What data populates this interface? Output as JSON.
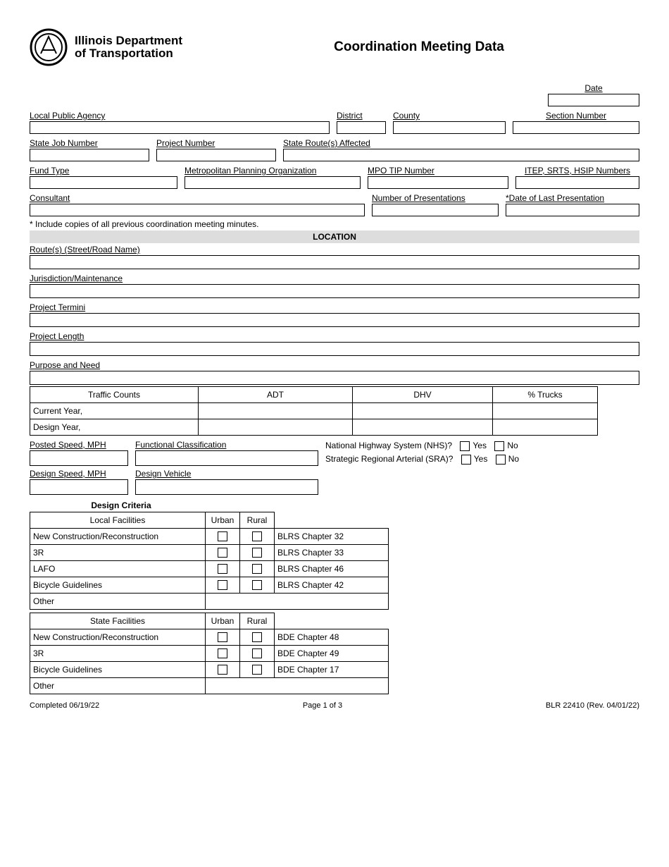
{
  "header": {
    "logo_line1": "Illinois Department",
    "logo_line2": "of Transportation",
    "title": "Coordination Meeting Data"
  },
  "top": {
    "date_label": "Date",
    "lpa_label": "Local Public Agency",
    "district_label": "District",
    "county_label": "County",
    "section_label": "Section Number",
    "state_job_label": "State Job Number",
    "project_number_label": "Project Number",
    "routes_affected_label": "State Route(s) Affected",
    "fund_type_label": "Fund Type",
    "mpo_label": "Metropolitan Planning Organization",
    "mpo_tip_label": "MPO TIP Number",
    "itep_label": "ITEP, SRTS, HSIP Numbers",
    "consultant_label": "Consultant",
    "num_presentations_label": "Number of Presentations",
    "last_presentation_label": "*Date of Last Presentation",
    "note": "* Include copies of all previous coordination meeting minutes."
  },
  "location": {
    "heading": "LOCATION",
    "routes_label": "Route(s) (Street/Road Name)",
    "jurisdiction_label": "Jurisdiction/Maintenance",
    "termini_label": "Project Termini",
    "length_label": "Project Length",
    "purpose_label": "Purpose and Need"
  },
  "traffic": {
    "col0": "Traffic Counts",
    "col1": "ADT",
    "col2": "DHV",
    "col3": "% Trucks",
    "row1": "Current Year,",
    "row2": "Design Year,"
  },
  "speed": {
    "posted_label": "Posted Speed, MPH",
    "functional_label": "Functional Classification",
    "nhs_label": "National Highway System (NHS)?",
    "sra_label": "Strategic Regional Arterial (SRA)?",
    "yes": "Yes",
    "no": "No",
    "design_speed_label": "Design Speed, MPH",
    "design_vehicle_label": "Design Vehicle"
  },
  "design_criteria": {
    "heading": "Design Criteria",
    "local": {
      "title": "Local Facilities",
      "urban": "Urban",
      "rural": "Rural",
      "rows": [
        {
          "name": "New Construction/Reconstruction",
          "ref": "BLRS Chapter 32"
        },
        {
          "name": "3R",
          "ref": "BLRS Chapter 33"
        },
        {
          "name": "LAFO",
          "ref": "BLRS Chapter 46"
        },
        {
          "name": "Bicycle Guidelines",
          "ref": "BLRS Chapter 42"
        },
        {
          "name": "Other",
          "ref": ""
        }
      ]
    },
    "state": {
      "title": "State Facilities",
      "urban": "Urban",
      "rural": "Rural",
      "rows": [
        {
          "name": "New Construction/Reconstruction",
          "ref": "BDE Chapter 48"
        },
        {
          "name": "3R",
          "ref": "BDE Chapter 49"
        },
        {
          "name": "Bicycle Guidelines",
          "ref": "BDE Chapter 17"
        },
        {
          "name": "Other",
          "ref": ""
        }
      ]
    }
  },
  "footer": {
    "completed": "Completed 06/19/22",
    "page": "Page 1 of 3",
    "rev": "BLR 22410 (Rev. 04/01/22)"
  }
}
